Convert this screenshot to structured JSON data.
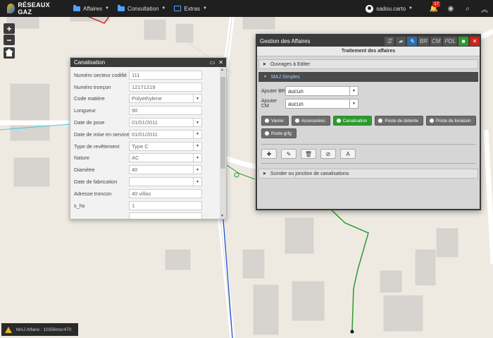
{
  "app": {
    "logo_text": "RÉSEAUX GAZ"
  },
  "menu": [
    {
      "label": "Affaires",
      "icon": "folder-icon"
    },
    {
      "label": "Consultation",
      "icon": "folder-icon"
    },
    {
      "label": "Extras",
      "icon": "extras-icon"
    }
  ],
  "topbar": {
    "user": "sadou.carto",
    "notifications": "17"
  },
  "canalisation": {
    "title": "Canalisation",
    "fields": [
      {
        "label": "Numéro secteur codifié",
        "value": "111",
        "type": "text"
      },
      {
        "label": "Numéro tronçon",
        "value": "12171219",
        "type": "text"
      },
      {
        "label": "Code matière",
        "value": "Polyethylene",
        "type": "select"
      },
      {
        "label": "Longueur",
        "value": "90",
        "type": "text"
      },
      {
        "label": "Date de pose",
        "value": "01/01/2011",
        "type": "select"
      },
      {
        "label": "Date de mise en service",
        "value": "01/01/2011",
        "type": "select"
      },
      {
        "label": "Type de revêtement",
        "value": "Type C",
        "type": "select"
      },
      {
        "label": "Nature",
        "value": "AC",
        "type": "select"
      },
      {
        "label": "Diamètre",
        "value": "40",
        "type": "select"
      },
      {
        "label": "Date de fabrication",
        "value": "",
        "type": "select"
      },
      {
        "label": "Adresse troncon",
        "value": "40 villas",
        "type": "text"
      },
      {
        "label": "s_hs",
        "value": "1",
        "type": "text"
      },
      {
        "label": "",
        "value": "",
        "type": "text"
      }
    ]
  },
  "gestion": {
    "title": "Gestion des Affaires",
    "header_icons": [
      "BR",
      "CM",
      "PDL"
    ],
    "subtitle": "Traitement des affaires",
    "ouvrages": "Ouvrages à Editer",
    "maj": "MAJ Simples",
    "ajouter_br_label": "Ajouter BR",
    "ajouter_br_value": "aucun",
    "ajouter_cm_label": "Ajouter CM",
    "ajouter_cm_value": "aucun",
    "options": [
      "Vanne",
      "Accessoires",
      "Canalisation",
      "Poste de detente",
      "Poste de livraison",
      "Poste grfg"
    ],
    "selected_option": "Canalisation",
    "tool_glyphs": [
      "✚",
      "✎",
      "🗑",
      "⊘",
      "A"
    ],
    "scinder": "Scinder ou jonction de canalisations"
  },
  "status": {
    "text": "MAJ Affaire : 10356mcr470"
  },
  "colors": {
    "selected": "#2e9a2e",
    "accent_blue": "#2a6db0",
    "pipe_green": "#2e9a2e",
    "pipe_blue": "#1d4fd6",
    "pipe_cyan": "#3fcfe0"
  }
}
